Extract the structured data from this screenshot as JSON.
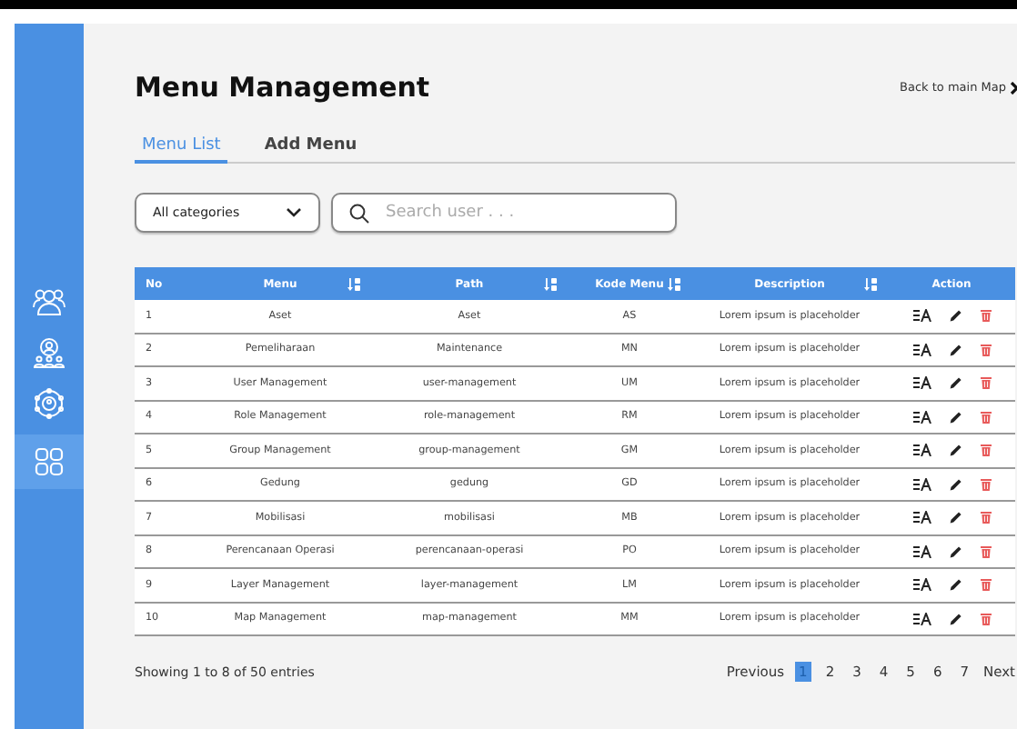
{
  "sidebar": {
    "items": [
      {
        "selected": false
      },
      {
        "selected": false
      },
      {
        "selected": false
      },
      {
        "selected": true
      }
    ]
  },
  "header": {
    "title": "Menu Management",
    "back_link": "Back to main Map"
  },
  "tabs": [
    {
      "label": "Menu List",
      "selected": true
    },
    {
      "label": "Add Menu",
      "selected": false
    }
  ],
  "filters": {
    "category": "All categories",
    "search": {
      "placeholder": "Search user . . ."
    }
  },
  "table": {
    "columns": [
      {
        "label": "No",
        "sortable": false
      },
      {
        "label": "Menu",
        "sortable": true
      },
      {
        "label": "Path",
        "sortable": true
      },
      {
        "label": "Kode Menu",
        "sortable": true
      },
      {
        "label": "Description",
        "sortable": true
      },
      {
        "label": "Action",
        "sortable": false
      }
    ],
    "rows": [
      [
        "1",
        "Aset",
        "Aset",
        "AS",
        "Lorem ipsum is placeholder"
      ],
      [
        "2",
        "Pemeliharaan",
        "Maintenance",
        "MN",
        "Lorem ipsum is placeholder"
      ],
      [
        "3",
        "User Management",
        "user-management",
        "UM",
        "Lorem ipsum is placeholder"
      ],
      [
        "4",
        "Role Management",
        "role-management",
        "RM",
        "Lorem ipsum is placeholder"
      ],
      [
        "5",
        "Group Management",
        "group-management",
        "GM",
        "Lorem ipsum is placeholder"
      ],
      [
        "6",
        "Gedung",
        "gedung",
        "GD",
        "Lorem ipsum is placeholder"
      ],
      [
        "7",
        "Mobilisasi",
        "mobilisasi",
        "MB",
        "Lorem ipsum is placeholder"
      ],
      [
        "8",
        "Perencanaan Operasi",
        "perencanaan-operasi",
        "PO",
        "Lorem ipsum is placeholder"
      ],
      [
        "9",
        "Layer Management",
        "layer-management",
        "LM",
        "Lorem ipsum is placeholder"
      ],
      [
        "10",
        "Map Management",
        "map-management",
        "MM",
        "Lorem ipsum is placeholder"
      ]
    ]
  },
  "footer": {
    "summary": "Showing 1 to 8 of 50 entries",
    "previous": "Previous",
    "next": "Next",
    "pages": [
      {
        "label": "1",
        "selected": true
      },
      {
        "label": "2",
        "selected": false
      },
      {
        "label": "3",
        "selected": false
      },
      {
        "label": "4",
        "selected": false
      },
      {
        "label": "5",
        "selected": false
      },
      {
        "label": "6",
        "selected": false
      },
      {
        "label": "7",
        "selected": false
      }
    ]
  }
}
